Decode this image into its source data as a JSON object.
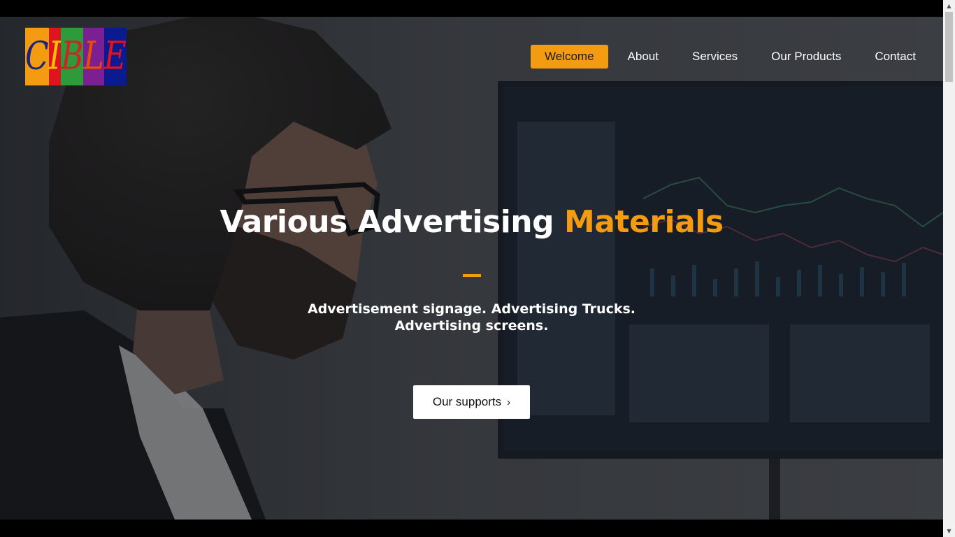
{
  "logo": {
    "letters": [
      "C",
      "I",
      "B",
      "L",
      "E"
    ],
    "bg_colors": [
      "#f39c12",
      "#e0141e",
      "#2e9b3a",
      "#7b1f93",
      "#0a1a8f"
    ],
    "fg_colors": [
      "#1a237e",
      "#f5c000",
      "#c62828",
      "#e65100",
      "#e0141e"
    ]
  },
  "nav": {
    "items": [
      {
        "label": "Welcome",
        "active": true
      },
      {
        "label": "About"
      },
      {
        "label": "Services"
      },
      {
        "label": "Our Products"
      },
      {
        "label": "Contact"
      }
    ]
  },
  "hero": {
    "headline_main": "Various Advertising ",
    "headline_accent": "Materials",
    "subtitle": "Advertisement signage. Advertising Trucks. Advertising screens.",
    "cta_label": "Our supports",
    "cta_chevron": "›"
  },
  "colors": {
    "accent": "#f39c12",
    "overlay": "#2e3136"
  }
}
